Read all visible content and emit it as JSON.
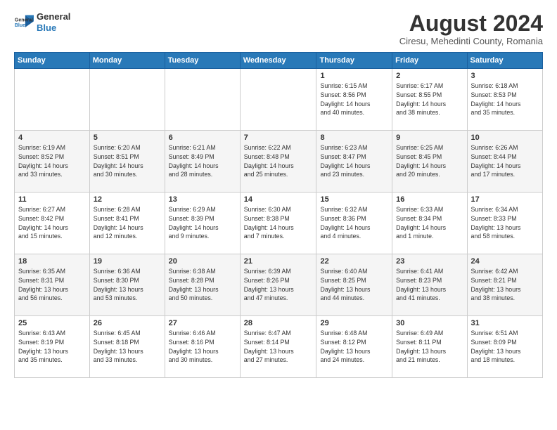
{
  "header": {
    "logo_line1": "General",
    "logo_line2": "Blue",
    "title": "August 2024",
    "subtitle": "Ciresu, Mehedinti County, Romania"
  },
  "calendar": {
    "weekdays": [
      "Sunday",
      "Monday",
      "Tuesday",
      "Wednesday",
      "Thursday",
      "Friday",
      "Saturday"
    ],
    "weeks": [
      [
        {
          "day": "",
          "info": ""
        },
        {
          "day": "",
          "info": ""
        },
        {
          "day": "",
          "info": ""
        },
        {
          "day": "",
          "info": ""
        },
        {
          "day": "1",
          "info": "Sunrise: 6:15 AM\nSunset: 8:56 PM\nDaylight: 14 hours\nand 40 minutes."
        },
        {
          "day": "2",
          "info": "Sunrise: 6:17 AM\nSunset: 8:55 PM\nDaylight: 14 hours\nand 38 minutes."
        },
        {
          "day": "3",
          "info": "Sunrise: 6:18 AM\nSunset: 8:53 PM\nDaylight: 14 hours\nand 35 minutes."
        }
      ],
      [
        {
          "day": "4",
          "info": "Sunrise: 6:19 AM\nSunset: 8:52 PM\nDaylight: 14 hours\nand 33 minutes."
        },
        {
          "day": "5",
          "info": "Sunrise: 6:20 AM\nSunset: 8:51 PM\nDaylight: 14 hours\nand 30 minutes."
        },
        {
          "day": "6",
          "info": "Sunrise: 6:21 AM\nSunset: 8:49 PM\nDaylight: 14 hours\nand 28 minutes."
        },
        {
          "day": "7",
          "info": "Sunrise: 6:22 AM\nSunset: 8:48 PM\nDaylight: 14 hours\nand 25 minutes."
        },
        {
          "day": "8",
          "info": "Sunrise: 6:23 AM\nSunset: 8:47 PM\nDaylight: 14 hours\nand 23 minutes."
        },
        {
          "day": "9",
          "info": "Sunrise: 6:25 AM\nSunset: 8:45 PM\nDaylight: 14 hours\nand 20 minutes."
        },
        {
          "day": "10",
          "info": "Sunrise: 6:26 AM\nSunset: 8:44 PM\nDaylight: 14 hours\nand 17 minutes."
        }
      ],
      [
        {
          "day": "11",
          "info": "Sunrise: 6:27 AM\nSunset: 8:42 PM\nDaylight: 14 hours\nand 15 minutes."
        },
        {
          "day": "12",
          "info": "Sunrise: 6:28 AM\nSunset: 8:41 PM\nDaylight: 14 hours\nand 12 minutes."
        },
        {
          "day": "13",
          "info": "Sunrise: 6:29 AM\nSunset: 8:39 PM\nDaylight: 14 hours\nand 9 minutes."
        },
        {
          "day": "14",
          "info": "Sunrise: 6:30 AM\nSunset: 8:38 PM\nDaylight: 14 hours\nand 7 minutes."
        },
        {
          "day": "15",
          "info": "Sunrise: 6:32 AM\nSunset: 8:36 PM\nDaylight: 14 hours\nand 4 minutes."
        },
        {
          "day": "16",
          "info": "Sunrise: 6:33 AM\nSunset: 8:34 PM\nDaylight: 14 hours\nand 1 minute."
        },
        {
          "day": "17",
          "info": "Sunrise: 6:34 AM\nSunset: 8:33 PM\nDaylight: 13 hours\nand 58 minutes."
        }
      ],
      [
        {
          "day": "18",
          "info": "Sunrise: 6:35 AM\nSunset: 8:31 PM\nDaylight: 13 hours\nand 56 minutes."
        },
        {
          "day": "19",
          "info": "Sunrise: 6:36 AM\nSunset: 8:30 PM\nDaylight: 13 hours\nand 53 minutes."
        },
        {
          "day": "20",
          "info": "Sunrise: 6:38 AM\nSunset: 8:28 PM\nDaylight: 13 hours\nand 50 minutes."
        },
        {
          "day": "21",
          "info": "Sunrise: 6:39 AM\nSunset: 8:26 PM\nDaylight: 13 hours\nand 47 minutes."
        },
        {
          "day": "22",
          "info": "Sunrise: 6:40 AM\nSunset: 8:25 PM\nDaylight: 13 hours\nand 44 minutes."
        },
        {
          "day": "23",
          "info": "Sunrise: 6:41 AM\nSunset: 8:23 PM\nDaylight: 13 hours\nand 41 minutes."
        },
        {
          "day": "24",
          "info": "Sunrise: 6:42 AM\nSunset: 8:21 PM\nDaylight: 13 hours\nand 38 minutes."
        }
      ],
      [
        {
          "day": "25",
          "info": "Sunrise: 6:43 AM\nSunset: 8:19 PM\nDaylight: 13 hours\nand 35 minutes."
        },
        {
          "day": "26",
          "info": "Sunrise: 6:45 AM\nSunset: 8:18 PM\nDaylight: 13 hours\nand 33 minutes."
        },
        {
          "day": "27",
          "info": "Sunrise: 6:46 AM\nSunset: 8:16 PM\nDaylight: 13 hours\nand 30 minutes."
        },
        {
          "day": "28",
          "info": "Sunrise: 6:47 AM\nSunset: 8:14 PM\nDaylight: 13 hours\nand 27 minutes."
        },
        {
          "day": "29",
          "info": "Sunrise: 6:48 AM\nSunset: 8:12 PM\nDaylight: 13 hours\nand 24 minutes."
        },
        {
          "day": "30",
          "info": "Sunrise: 6:49 AM\nSunset: 8:11 PM\nDaylight: 13 hours\nand 21 minutes."
        },
        {
          "day": "31",
          "info": "Sunrise: 6:51 AM\nSunset: 8:09 PM\nDaylight: 13 hours\nand 18 minutes."
        }
      ]
    ]
  }
}
